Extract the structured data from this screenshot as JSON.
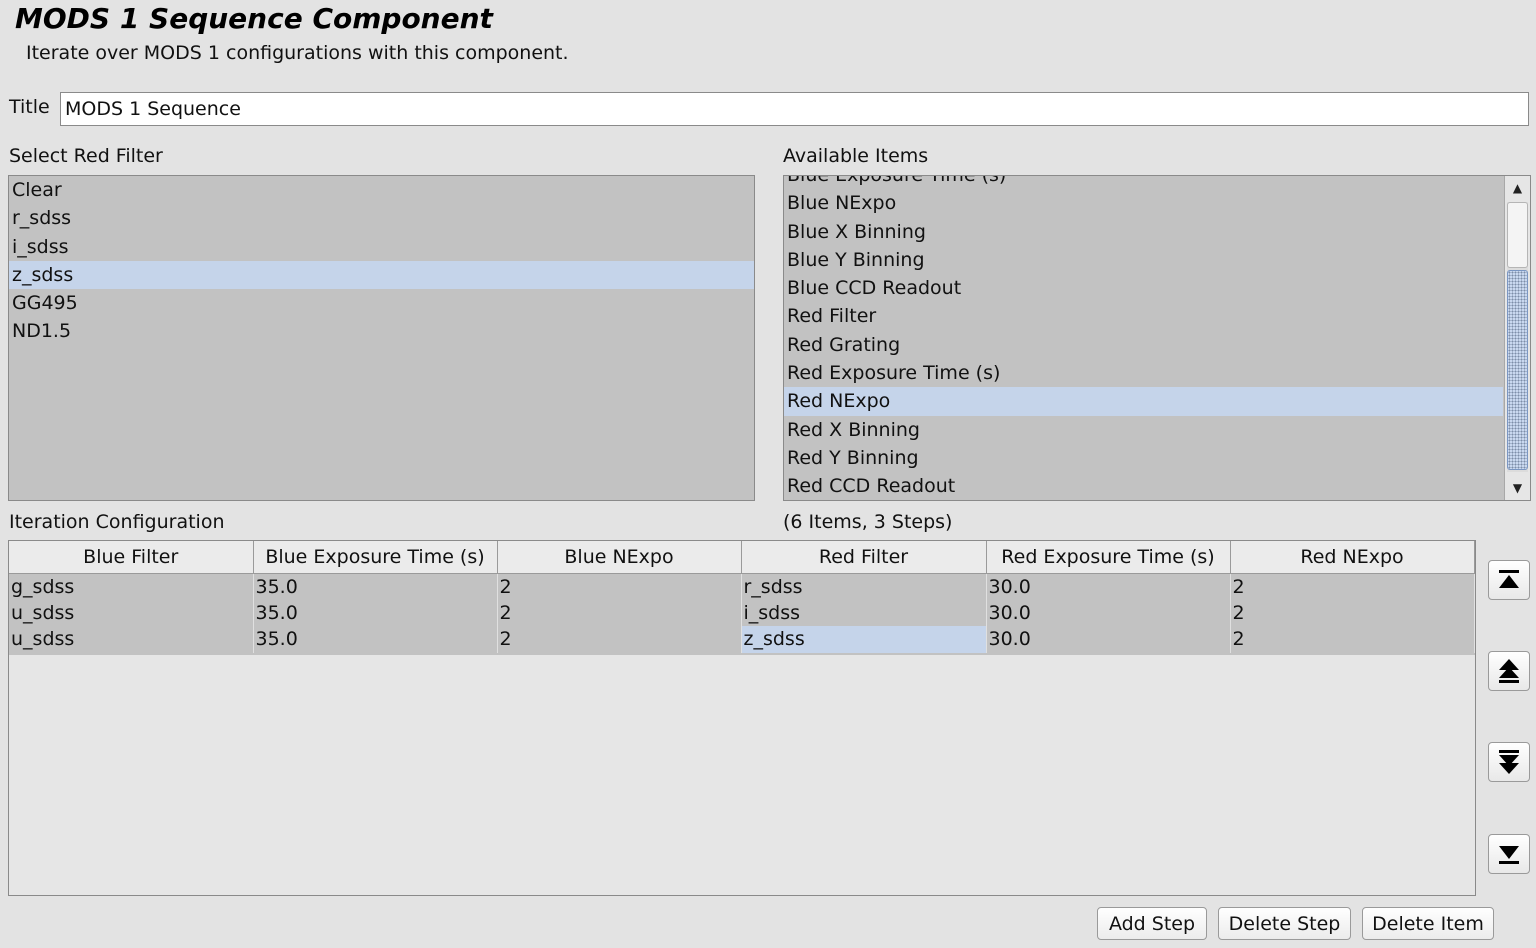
{
  "header": {
    "title": "MODS 1 Sequence Component",
    "subtitle": "Iterate over MODS 1 configurations with this component."
  },
  "title_field": {
    "label": "Title",
    "value": "MODS 1 Sequence"
  },
  "red_filter": {
    "label": "Select Red Filter",
    "items": [
      "Clear",
      "r_sdss",
      "i_sdss",
      "z_sdss",
      "GG495",
      "ND1.5"
    ],
    "selected": "z_sdss"
  },
  "available_items": {
    "label": "Available Items",
    "items": [
      "Blue Exposure Time (s)",
      "Blue NExpo",
      "Blue X Binning",
      "Blue Y Binning",
      "Blue CCD Readout",
      "Red Filter",
      "Red Grating",
      "Red Exposure Time (s)",
      "Red NExpo",
      "Red X Binning",
      "Red Y Binning",
      "Red CCD Readout"
    ],
    "selected": "Red NExpo"
  },
  "iteration": {
    "label": "Iteration Configuration",
    "count": "(6 Items, 3 Steps)",
    "columns": [
      "Blue Filter",
      "Blue Exposure Time (s)",
      "Blue NExpo",
      "Red Filter",
      "Red Exposure Time (s)",
      "Red NExpo"
    ],
    "rows": [
      [
        "g_sdss",
        "35.0",
        "2",
        "r_sdss",
        "30.0",
        "2"
      ],
      [
        "u_sdss",
        "35.0",
        "2",
        "i_sdss",
        "30.0",
        "2"
      ],
      [
        "u_sdss",
        "35.0",
        "2",
        "z_sdss",
        "30.0",
        "2"
      ]
    ],
    "selected_cell": {
      "row": 2,
      "col": 3
    }
  },
  "buttons": {
    "add_step": "Add Step",
    "delete_step": "Delete Step",
    "delete_item": "Delete Item"
  },
  "icons": {
    "move_top": "move-to-top-icon",
    "move_up": "move-up-icon",
    "move_down": "move-down-icon",
    "move_bottom": "move-to-bottom-icon",
    "scroll_up": "scroll-up-arrow-icon",
    "scroll_down": "scroll-down-arrow-icon"
  },
  "colors": {
    "selection": "#c5d4ea",
    "list_background": "#c2c2c2",
    "window_background": "#e3e3e3"
  }
}
